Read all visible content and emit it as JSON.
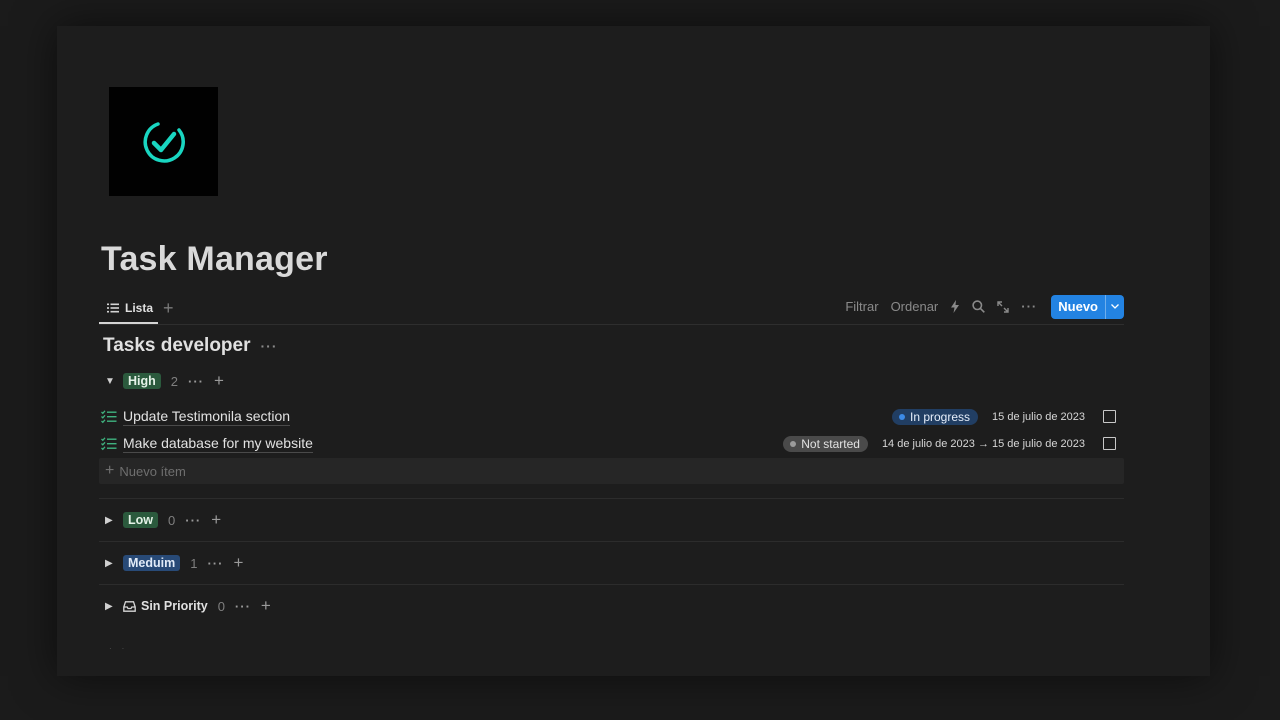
{
  "page": {
    "title": "Task Manager"
  },
  "cover": {
    "icon": "check-circle-icon",
    "accent_color": "#19d6c1"
  },
  "view_tabs": {
    "active_label": "Lista",
    "add_label": "+"
  },
  "toolbar": {
    "filter_label": "Filtrar",
    "sort_label": "Ordenar",
    "icons": [
      "lightning-icon",
      "search-icon",
      "expand-icon",
      "more-icon"
    ],
    "new_label": "Nuevo",
    "new_color": "#2383e2"
  },
  "database": {
    "title": "Tasks developer",
    "more_label": "···"
  },
  "groups": [
    {
      "label": "High",
      "count": "2",
      "expanded": true,
      "color": "#2b5a3d",
      "items": [
        {
          "name": "Update Testimonila section",
          "status": "In progress",
          "status_color": "#3c8ae6",
          "date": "15 de julio de 2023"
        },
        {
          "name": "Make database for my website",
          "status": "Not started",
          "status_color": "#9b9b9b",
          "date": "14 de julio de 2023 → 15 de julio de 2023"
        }
      ],
      "new_item_label": "Nuevo ítem"
    },
    {
      "label": "Low",
      "count": "0",
      "expanded": false,
      "color": "#2b5a3d"
    },
    {
      "label": "Meduim",
      "count": "1",
      "expanded": false,
      "color": "#284a77"
    },
    {
      "label": "Sin Priority",
      "count": "0",
      "expanded": false,
      "icon": "inbox-icon"
    }
  ],
  "group_actions": {
    "more_label": "···",
    "add_label": "+"
  }
}
